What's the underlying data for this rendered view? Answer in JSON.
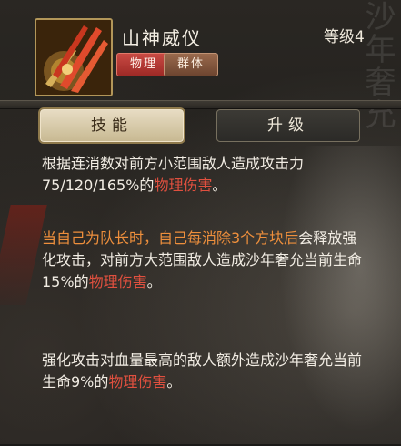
{
  "background_text": "沙年奢允",
  "skill": {
    "name": "山神威仪",
    "level": "等级4",
    "icon": "claw-slash-icon",
    "tags": {
      "physical": "物理",
      "group": "群体"
    }
  },
  "tabs": {
    "skill": "技能",
    "upgrade": "升级"
  },
  "description": {
    "p1": {
      "a": "根据连消数对前方小范围敌人造成攻击力75/120/165%的",
      "b": "物理伤害",
      "c": "。"
    },
    "p2": {
      "a": "当自己为队长时，自己每消除3个方块后",
      "b": "会释放强化攻击，对前方大范围敌人造成沙年奢允当前生命15%的",
      "c": "物理伤害",
      "d": "。"
    },
    "p3": {
      "a": "强化攻击对血量最高的敌人额外造成沙年奢允当前生命9%的",
      "b": "物理伤害",
      "c": "。"
    }
  },
  "colors": {
    "highlight_orange": "#ee8f3c",
    "highlight_red": "#e0503f",
    "tag_physical": "#b83a35",
    "tag_group": "#8a5b40"
  }
}
